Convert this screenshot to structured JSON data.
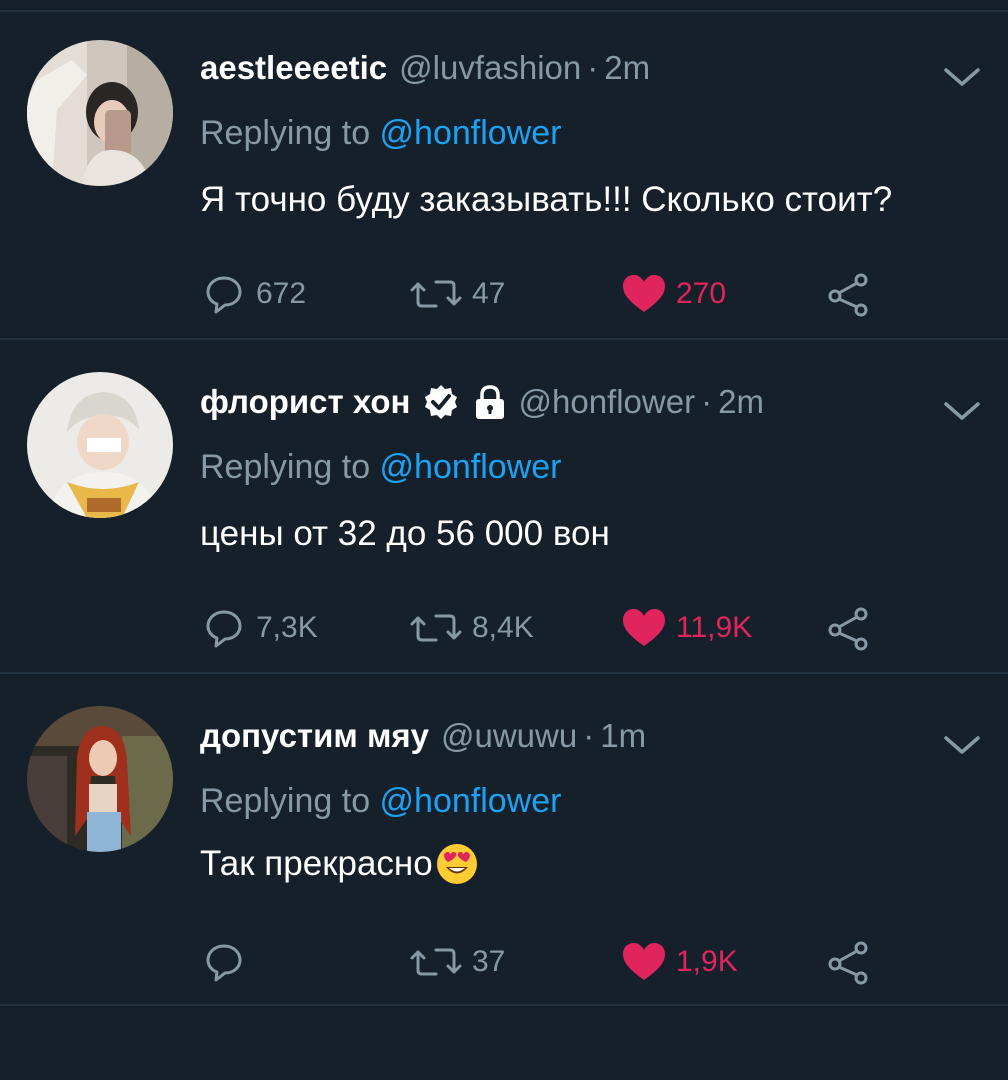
{
  "tweets": [
    {
      "name": "aestleeeetic",
      "handle": "@luvfashion",
      "separator": "·",
      "time": "2m",
      "replying_prefix": "Replying to ",
      "replying_to": "@honflower",
      "text": "Я точно буду заказывать!!! Сколько стоит?",
      "replies": "672",
      "retweets": "47",
      "likes": "270",
      "verified": false,
      "protected": false,
      "emoji": null
    },
    {
      "name": "флорист хон",
      "handle": "@honflower",
      "separator": "·",
      "time": "2m",
      "replying_prefix": "Replying to ",
      "replying_to": "@honflower",
      "text": "цены от 32 до 56 000 вон",
      "replies": "7,3K",
      "retweets": "8,4K",
      "likes": "11,9K",
      "verified": true,
      "protected": true,
      "emoji": null
    },
    {
      "name": "допустим мяу",
      "handle": "@uwuwu",
      "separator": "·",
      "time": "1m",
      "replying_prefix": "Replying to ",
      "replying_to": "@honflower",
      "text": "Так прекрасно",
      "replies": "",
      "retweets": "37",
      "likes": "1,9K",
      "verified": false,
      "protected": false,
      "emoji": "heart-eyes-emoji"
    }
  ],
  "icons": {
    "reply": "speech-bubble-icon",
    "retweet": "retweet-arrows-icon",
    "like": "heart-filled-icon",
    "share": "share-nodes-icon",
    "menu": "chevron-down-icon",
    "verified": "verified-badge-icon",
    "protected": "lock-icon"
  },
  "colors": {
    "background": "#15202b",
    "divider": "#253341",
    "secondary_text": "#8899a6",
    "mention": "#1da1f2",
    "like": "#e0245e",
    "primary_text": "#ffffff"
  }
}
